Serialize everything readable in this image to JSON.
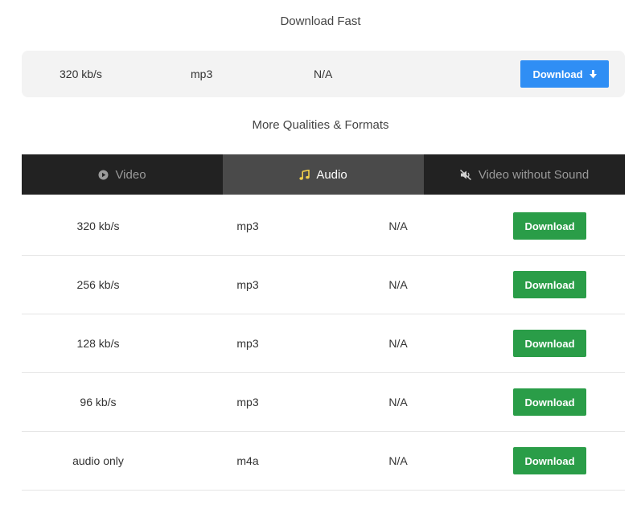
{
  "fast": {
    "heading": "Download Fast",
    "quality": "320 kb/s",
    "format": "mp3",
    "size": "N/A",
    "button_label": "Download",
    "button_color": "#2f8ef4"
  },
  "more": {
    "heading": "More Qualities & Formats"
  },
  "tabs": [
    {
      "label": "Video",
      "icon": "play-circle-icon",
      "active": false
    },
    {
      "label": "Audio",
      "icon": "music-note-icon",
      "active": true,
      "icon_color": "#f2d04b"
    },
    {
      "label": "Video without Sound",
      "icon": "mute-icon",
      "active": false
    }
  ],
  "rows": [
    {
      "quality": "320 kb/s",
      "format": "mp3",
      "size": "N/A",
      "button": "Download"
    },
    {
      "quality": "256 kb/s",
      "format": "mp3",
      "size": "N/A",
      "button": "Download"
    },
    {
      "quality": "128 kb/s",
      "format": "mp3",
      "size": "N/A",
      "button": "Download"
    },
    {
      "quality": "96 kb/s",
      "format": "mp3",
      "size": "N/A",
      "button": "Download"
    },
    {
      "quality": "audio only",
      "format": "m4a",
      "size": "N/A",
      "button": "Download"
    }
  ],
  "colors": {
    "download_green": "#2a9d48",
    "tab_bar": "#222222",
    "tab_active": "#4a4a4a"
  }
}
